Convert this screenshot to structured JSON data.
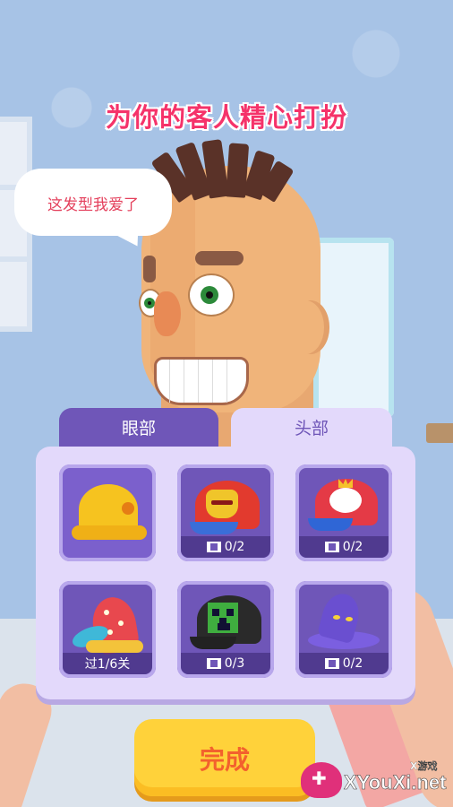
{
  "title": "为你的客人精心打扮",
  "speech": "这发型我爱了",
  "tabs": [
    {
      "label": "眼部",
      "active": true
    },
    {
      "label": "头部",
      "active": false
    }
  ],
  "items": [
    {
      "name": "yellow-hard-hat",
      "status": ""
    },
    {
      "name": "iron-man-cap",
      "status": "0/2"
    },
    {
      "name": "bunny-cap",
      "status": "0/2"
    },
    {
      "name": "jester-hat",
      "status": "过1/6关"
    },
    {
      "name": "creeper-cap",
      "status": "0/3"
    },
    {
      "name": "purple-witch-hat",
      "status": "0/2"
    }
  ],
  "done_label": "完成",
  "watermark": {
    "text": "XYouXi.net",
    "sub": "X游戏"
  },
  "colors": {
    "title": "#f5336a",
    "panel": "#e3d9fb",
    "accent": "#6f56b8",
    "button": "#ffd23a"
  }
}
